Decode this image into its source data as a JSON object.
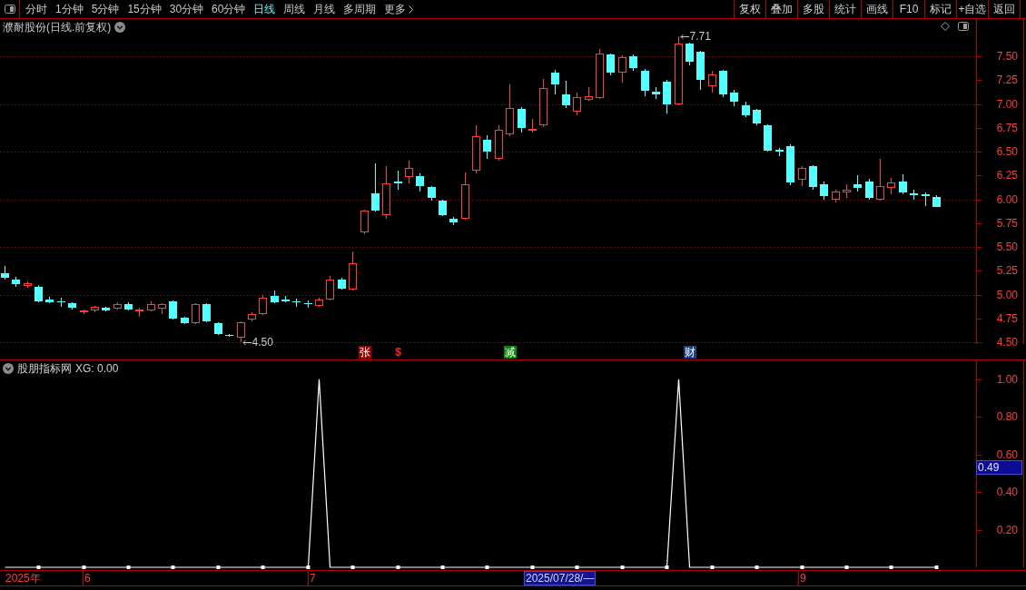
{
  "toolbar": {
    "tabs": [
      {
        "label": "分时",
        "selected": false
      },
      {
        "label": "1分钟",
        "selected": false
      },
      {
        "label": "5分钟",
        "selected": false
      },
      {
        "label": "15分钟",
        "selected": false
      },
      {
        "label": "30分钟",
        "selected": false
      },
      {
        "label": "60分钟",
        "selected": false
      },
      {
        "label": "日线",
        "selected": true
      },
      {
        "label": "周线",
        "selected": false
      },
      {
        "label": "月线",
        "selected": false
      },
      {
        "label": "多周期",
        "selected": false
      }
    ],
    "more_menu": {
      "label": "更多"
    },
    "buttons": [
      "复权",
      "叠加",
      "多股",
      "统计",
      "画线",
      "F10",
      "标记",
      "+自选",
      "返回"
    ]
  },
  "price_panel": {
    "title": "濮耐股份(日线.前复权)",
    "axis_labels": [
      "7.50",
      "7.25",
      "7.00",
      "6.75",
      "6.50",
      "6.25",
      "6.00",
      "5.75",
      "5.50",
      "5.25",
      "5.00",
      "4.75",
      "4.50"
    ],
    "annotations": [
      {
        "text": "4.50"
      },
      {
        "text": "7.71"
      }
    ],
    "markers": [
      {
        "kind": "badge",
        "text": "张",
        "color": "#a00000"
      },
      {
        "kind": "symbol",
        "text": "$",
        "color": "#ff2020"
      },
      {
        "kind": "badge",
        "text": "减",
        "color": "#008a00"
      },
      {
        "kind": "badge",
        "text": "财",
        "color": "#1c3f80"
      }
    ]
  },
  "indicator_panel": {
    "title": "股朋指标网",
    "reading": ": 0.00",
    "cursor_value": "0.49",
    "chart_data": {
      "type": "line",
      "series": [
        {
          "name": "XG",
          "color": "#ffffff",
          "values": [
            0,
            0,
            0,
            0,
            0,
            0,
            0,
            0,
            0,
            0,
            0,
            0,
            0,
            0,
            0,
            0,
            0,
            0,
            0,
            0,
            0,
            0,
            0,
            0,
            0,
            0,
            0,
            0,
            1,
            0,
            0,
            0,
            0,
            0,
            0,
            0,
            0,
            0,
            0,
            0,
            0,
            0,
            0,
            0,
            0,
            0,
            0,
            0,
            0,
            0,
            0,
            0,
            0,
            0,
            0,
            0,
            0,
            0,
            0,
            0,
            1,
            0,
            0,
            0,
            0,
            0,
            0,
            0,
            0,
            0,
            0,
            0,
            0,
            0,
            0,
            0,
            0,
            0,
            0,
            0,
            0,
            0,
            0,
            0
          ]
        }
      ],
      "ylim": [
        0,
        1.1
      ],
      "yticks": [
        {
          "value": 0.2,
          "label": "0.20"
        },
        {
          "value": 0.4,
          "label": "0.40"
        },
        {
          "value": 0.6,
          "label": "0.60"
        },
        {
          "value": 0.8,
          "label": "0.80"
        },
        {
          "value": 1,
          "label": "1.00"
        }
      ]
    }
  },
  "time_axis": {
    "labels": [
      {
        "kind": "tick",
        "text": "2025年"
      },
      {
        "kind": "tick",
        "text": "6"
      },
      {
        "kind": "tick",
        "text": "7"
      },
      {
        "kind": "cursor",
        "text": "2025/07/28/—"
      },
      {
        "kind": "tick",
        "text": "9"
      }
    ]
  }
}
